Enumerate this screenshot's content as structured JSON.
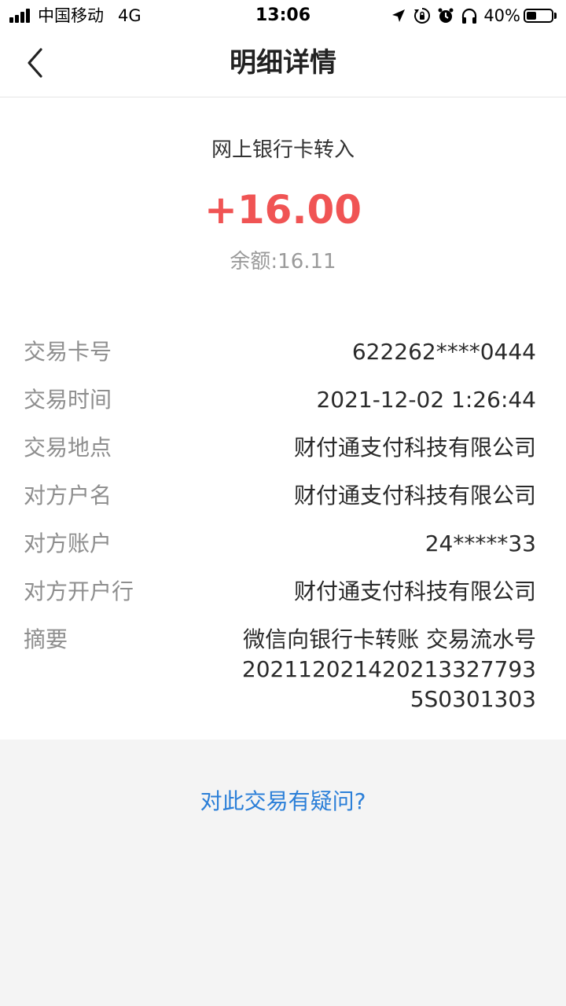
{
  "status_bar": {
    "carrier": "中国移动",
    "network": "4G",
    "time": "13:06",
    "battery_percent": "40%",
    "battery_level": 0.4,
    "icons": [
      "location-arrow-icon",
      "rotation-lock-icon",
      "alarm-icon",
      "headphones-icon",
      "battery-icon"
    ]
  },
  "nav": {
    "title": "明细详情",
    "back_icon": "chevron-left-icon"
  },
  "transaction": {
    "type": "网上银行卡转入",
    "amount": "+16.00",
    "balance": "余额:16.11",
    "amount_color": "#f05454"
  },
  "details": [
    {
      "label": "交易卡号",
      "value": "622262****0444"
    },
    {
      "label": "交易时间",
      "value": "2021-12-02 1:26:44"
    },
    {
      "label": "交易地点",
      "value": "财付通支付科技有限公司"
    },
    {
      "label": "对方户名",
      "value": "财付通支付科技有限公司"
    },
    {
      "label": "对方账户",
      "value": "24*****33"
    },
    {
      "label": "对方开户行",
      "value": "财付通支付科技有限公司"
    },
    {
      "label": "摘要",
      "value": "微信向银行卡转账 交易流水号2021120214202133277935S0301303"
    }
  ],
  "footer": {
    "question_link": "对此交易有疑问?",
    "link_color": "#2b7fd8"
  }
}
